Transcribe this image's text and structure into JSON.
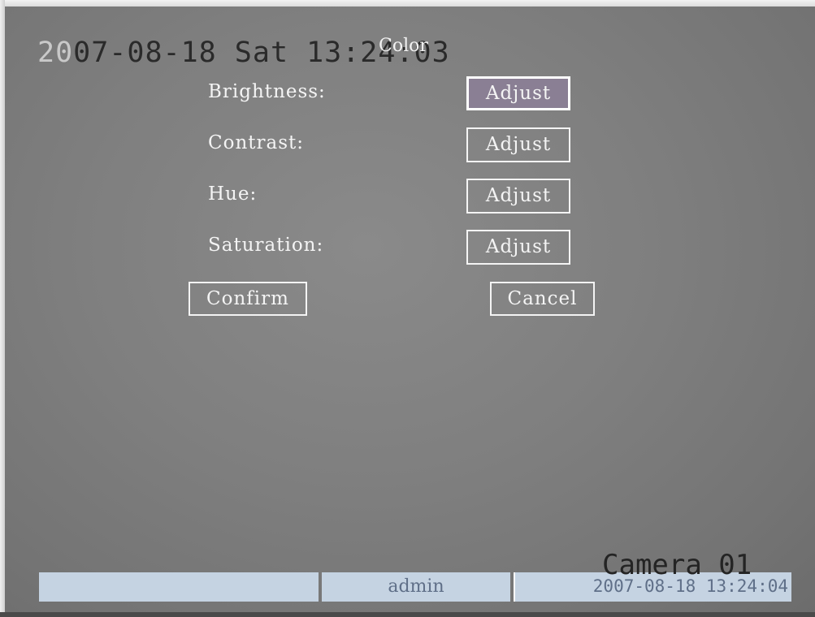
{
  "osd": {
    "datetime_dim": "20",
    "datetime_main": "07-08-18 Sat 13:24:03",
    "camera": "Camera 01"
  },
  "menu": {
    "title": "Color",
    "rows": [
      {
        "label": "Brightness:",
        "button": "Adjust",
        "selected": true
      },
      {
        "label": "Contrast:",
        "button": "Adjust",
        "selected": false
      },
      {
        "label": "Hue:",
        "button": "Adjust",
        "selected": false
      },
      {
        "label": "Saturation:",
        "button": "Adjust",
        "selected": false
      }
    ],
    "confirm": "Confirm",
    "cancel": "Cancel"
  },
  "statusbar": {
    "left": "",
    "user": "admin",
    "datetime": "2007-08-18 13:24:04"
  },
  "colors": {
    "screen_bg": "#808080",
    "text": "#f4f4f4",
    "selected_bg": "#8a7f94",
    "statusbar_bg": "#c5d3e2",
    "statusbar_text": "#5f6f88"
  }
}
